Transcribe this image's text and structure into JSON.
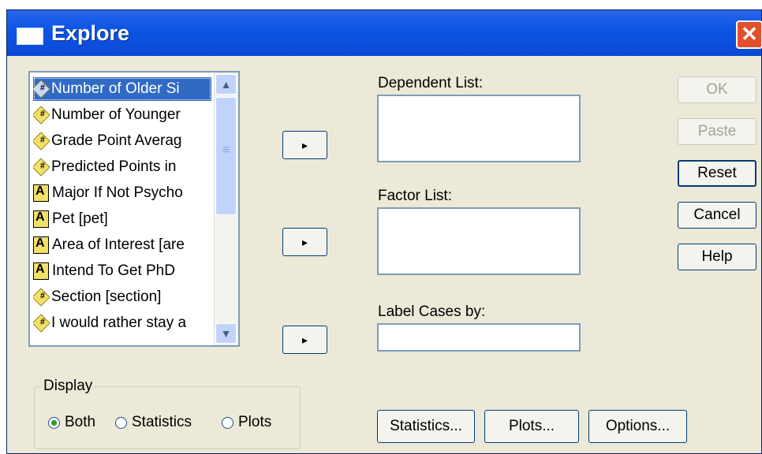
{
  "window": {
    "title": "Explore",
    "close_glyph": "✕"
  },
  "variables": [
    {
      "label": "Number of Older Si",
      "type": "numeric",
      "selected": true
    },
    {
      "label": "Number of Younger",
      "type": "numeric"
    },
    {
      "label": "Grade Point Averag",
      "type": "numeric"
    },
    {
      "label": "Predicted Points in",
      "type": "numeric"
    },
    {
      "label": "Major If Not Psycho",
      "type": "string"
    },
    {
      "label": "Pet [pet]",
      "type": "string"
    },
    {
      "label": "Area of Interest [are",
      "type": "string"
    },
    {
      "label": "Intend To Get PhD",
      "type": "string"
    },
    {
      "label": "Section [section]",
      "type": "numeric"
    },
    {
      "label": "I would rather stay a",
      "type": "numeric"
    }
  ],
  "scrollbar": {
    "up_glyph": "▲",
    "down_glyph": "▼"
  },
  "arrows": {
    "glyph": "▸"
  },
  "dependent_list": {
    "label": "Dependent List:"
  },
  "factor_list": {
    "label": "Factor List:"
  },
  "label_cases": {
    "label": "Label Cases by:"
  },
  "buttons": {
    "ok": "OK",
    "paste": "Paste",
    "reset": "Reset",
    "cancel": "Cancel",
    "help": "Help",
    "statistics": "Statistics...",
    "plots": "Plots...",
    "options": "Options..."
  },
  "display": {
    "title": "Display",
    "options": [
      {
        "label": "Both",
        "checked": true
      },
      {
        "label": "Statistics",
        "checked": false
      },
      {
        "label": "Plots",
        "checked": false
      }
    ]
  },
  "icons": {
    "numeric": "numeric-variable-icon",
    "string": "string-variable-icon",
    "window": "window-icon",
    "close": "close-icon"
  },
  "colors": {
    "title_bar": "#0a49d4",
    "selection": "#316ac5",
    "dialog_bg": "#ece9d8",
    "close_button": "#e2502b"
  }
}
